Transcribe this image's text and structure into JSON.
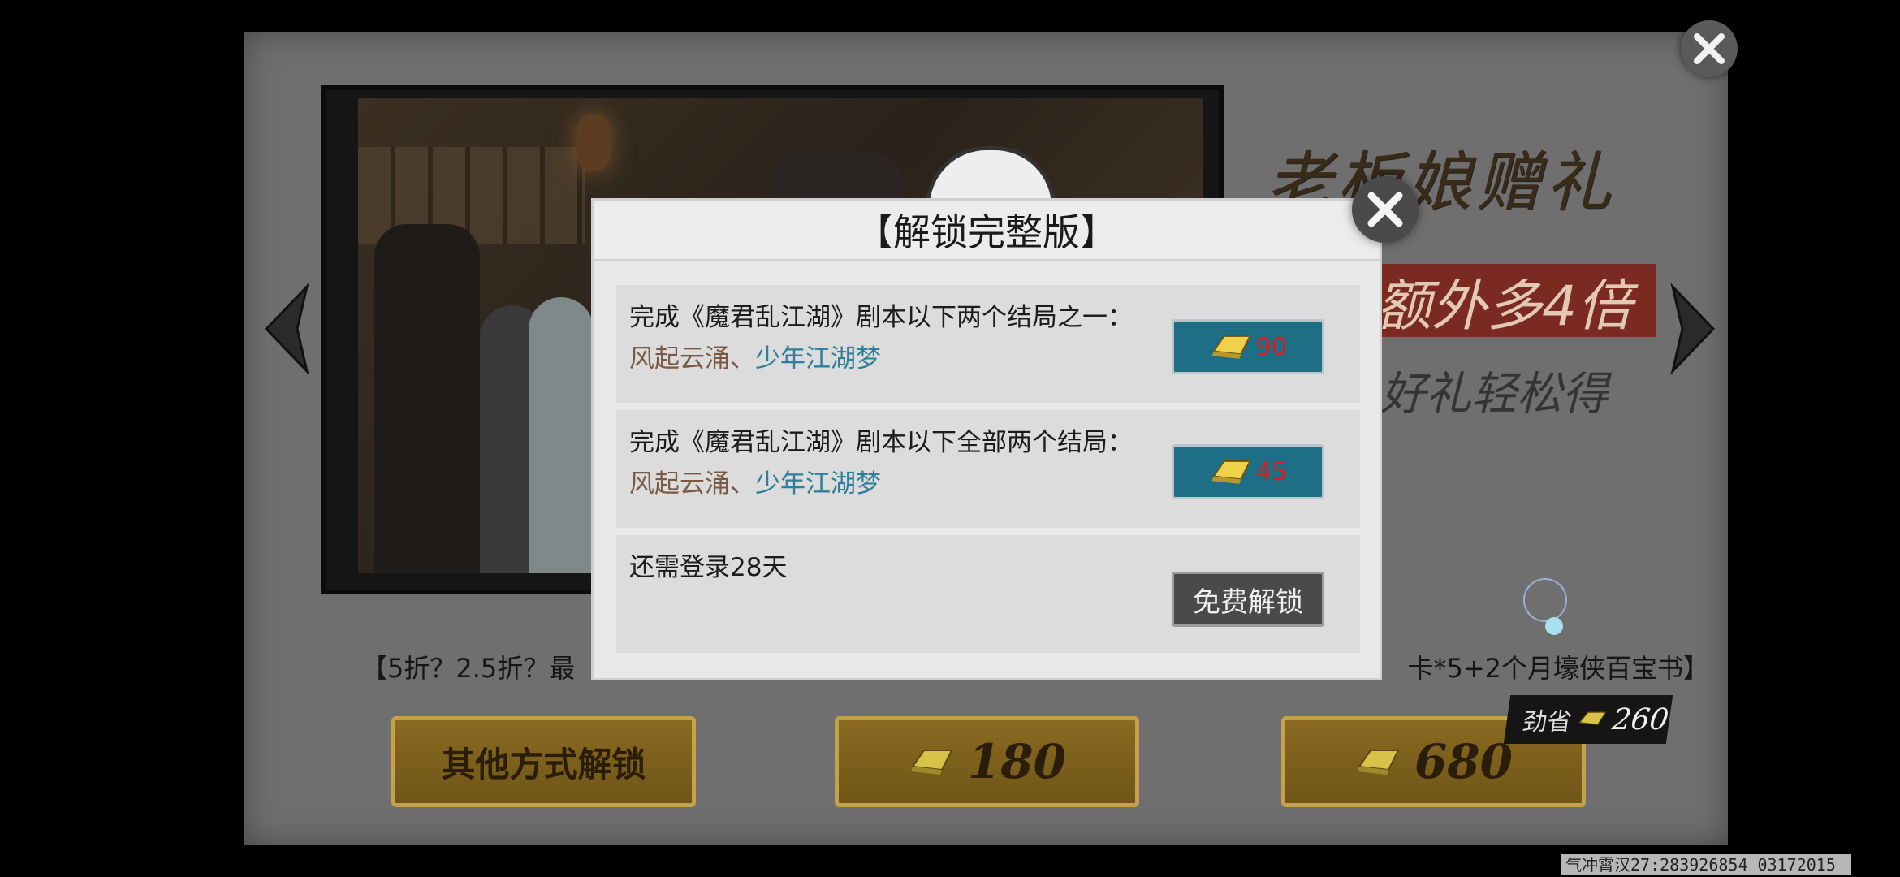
{
  "background": {
    "title_art": "老板娘赠礼",
    "tagline": "额外多4倍",
    "tagline2": "好礼轻松得",
    "promo_left": "【5折？2.5折？最",
    "promo_right": "卡*5+2个月壕侠百宝书】",
    "buttons": {
      "other_unlock": "其他方式解锁",
      "price_180": "180",
      "price_680": "680"
    },
    "save_badge": {
      "label": "劲省",
      "value": "260"
    },
    "footer_id": "气冲霄汉27:283926854 03172015"
  },
  "modal": {
    "title": "【解锁完整版】",
    "rows": [
      {
        "text": "完成《魔君乱江湖》剧本以下两个结局之一：",
        "ending_a": "风起云涌",
        "sep": "、",
        "ending_b": "少年江湖梦",
        "cost": "90"
      },
      {
        "text": "完成《魔君乱江湖》剧本以下全部两个结局：",
        "ending_a": "风起云涌",
        "sep": "、",
        "ending_b": "少年江湖梦",
        "cost": "45"
      },
      {
        "text": "还需登录28天",
        "button": "免费解锁"
      }
    ]
  },
  "colors": {
    "cost_text": "#e2181e",
    "ending_b": "#2f7f9a",
    "ending_a": "#7a5a44",
    "cost_button": "#1e6f86"
  }
}
